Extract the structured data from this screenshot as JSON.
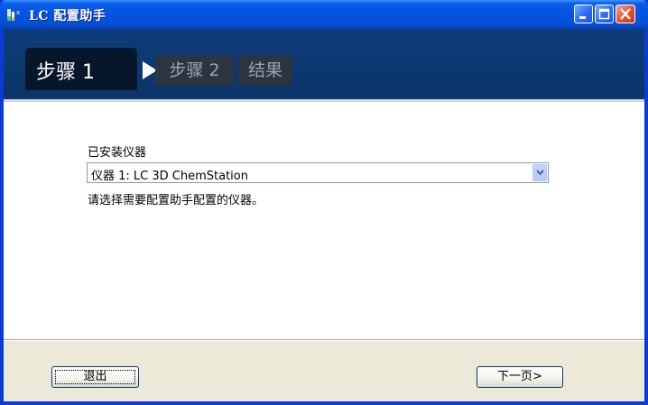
{
  "window": {
    "title": "LC 配置助手"
  },
  "steps": {
    "active_label": "步骤 1",
    "step2_label": "步骤 2",
    "result_label": "结果"
  },
  "form": {
    "field_label": "已安装仪器",
    "selected_instrument": "仪器 1: LC 3D ChemStation",
    "hint": "请选择需要配置助手配置的仪器。"
  },
  "footer": {
    "exit_label": "退出",
    "next_label": "下一页>"
  },
  "icons": {
    "app": "lc-flask-icon",
    "minimize": "minimize-icon",
    "maximize": "maximize-icon",
    "close": "close-icon",
    "dropdown": "chevron-down-icon",
    "step_arrow": "triangle-right-icon"
  },
  "colors": {
    "titlebar": "#0554e3",
    "header_bg": "#0d3e80",
    "active_step_bg": "#07162b",
    "inactive_step_bg": "#2b3441",
    "footer_bg": "#ece9d8"
  }
}
